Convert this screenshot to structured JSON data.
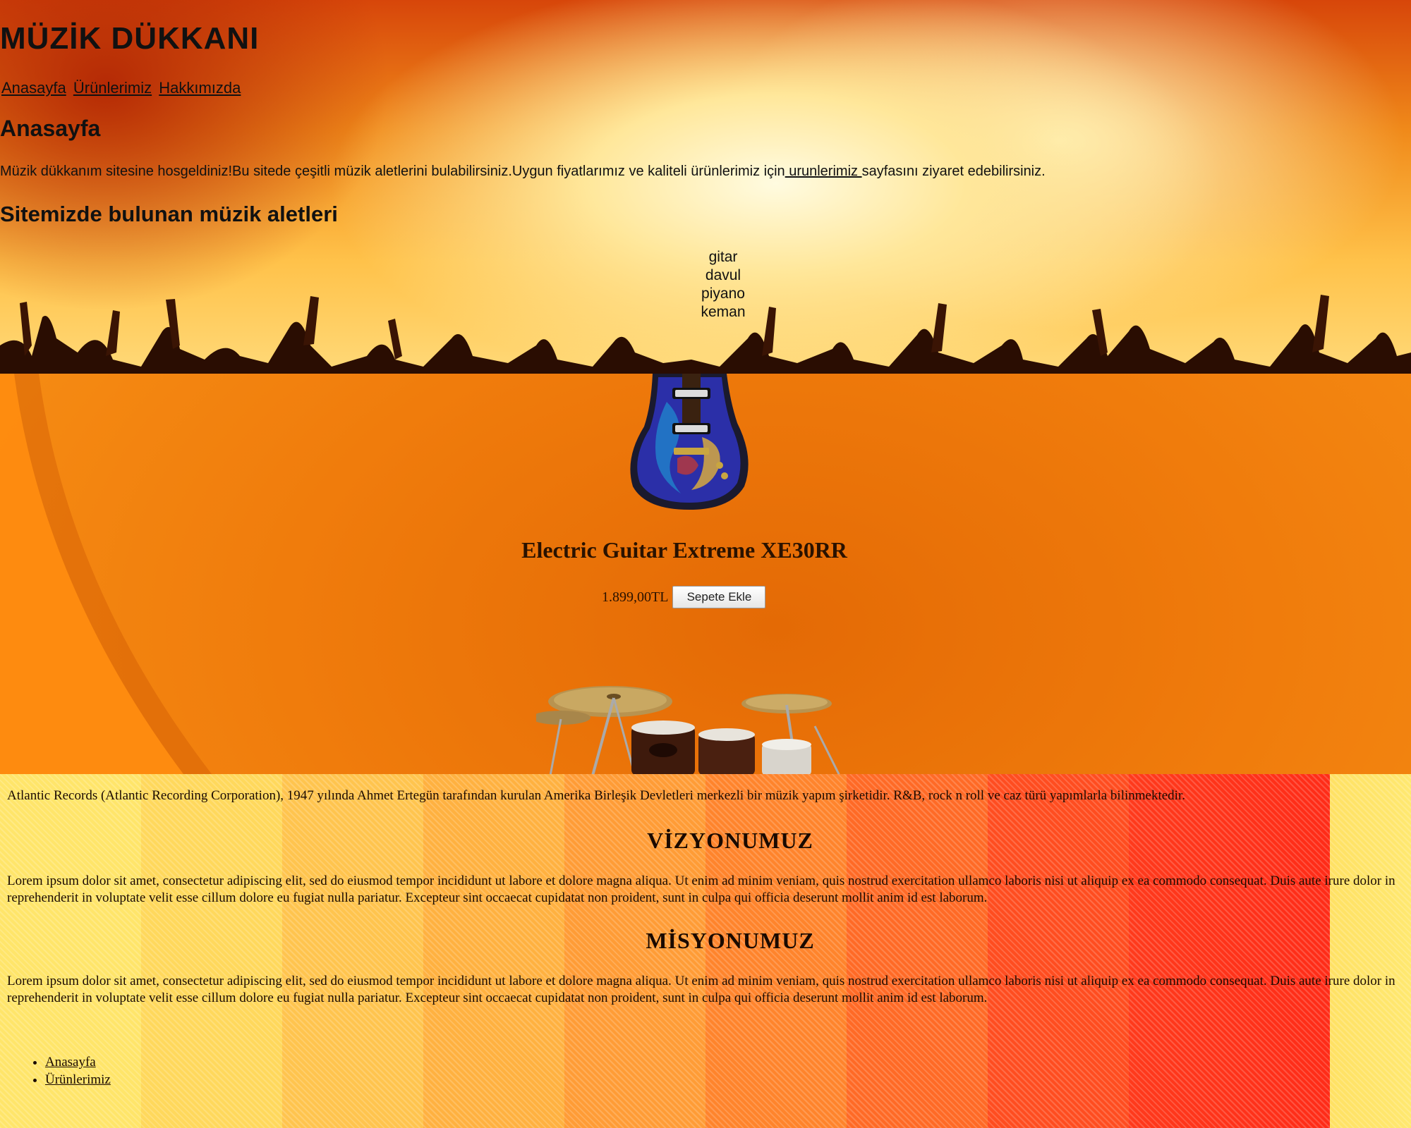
{
  "header": {
    "site_title": "MÜZİK DÜKKANI",
    "nav": [
      "Anasayfa",
      "Ürünlerimiz",
      "Hakkımızda"
    ],
    "page_heading": "Anasayfa",
    "welcome_before": "Müzik dükkanım sitesine hosgeldiniz!Bu sitede çeşitli müzik aletlerini bulabilirsiniz.Uygun fiyatlarımız ve kaliteli ürünlerimiz için",
    "welcome_link": " urunlerimiz ",
    "welcome_after": "sayfasını ziyaret edebilirsiniz.",
    "instruments_heading": "Sitemizde bulunan müzik aletleri",
    "instruments": [
      "gitar",
      "davul",
      "piyano",
      "keman"
    ]
  },
  "product": {
    "name": "Electric Guitar Extreme XE30RR",
    "price": "1.899,00TL",
    "add_to_cart": "Sepete Ekle"
  },
  "about": {
    "intro": "Atlantic Records (Atlantic Recording Corporation), 1947 yılında Ahmet Ertegün tarafından kurulan Amerika Birleşik Devletleri merkezli bir müzik yapım şirketidir. R&B, rock n roll ve caz türü yapımlarla bilinmektedir.",
    "vision_heading": "VİZYONUMUZ",
    "vision_text": "Lorem ipsum dolor sit amet, consectetur adipiscing elit, sed do eiusmod tempor incididunt ut labore et dolore magna aliqua. Ut enim ad minim veniam, quis nostrud exercitation ullamco laboris nisi ut aliquip ex ea commodo consequat. Duis aute irure dolor in reprehenderit in voluptate velit esse cillum dolore eu fugiat nulla pariatur. Excepteur sint occaecat cupidatat non proident, sunt in culpa qui officia deserunt mollit anim id est laborum.",
    "mission_heading": "MİSYONUMUZ",
    "mission_text": "Lorem ipsum dolor sit amet, consectetur adipiscing elit, sed do eiusmod tempor incididunt ut labore et dolore magna aliqua. Ut enim ad minim veniam, quis nostrud exercitation ullamco laboris nisi ut aliquip ex ea commodo consequat. Duis aute irure dolor in reprehenderit in voluptate velit esse cillum dolore eu fugiat nulla pariatur. Excepteur sint occaecat cupidatat non proident, sunt in culpa qui officia deserunt mollit anim id est laborum.",
    "bottom_nav": [
      "Anasayfa",
      "Ürünlerimiz"
    ]
  },
  "images": {
    "hero_background": "concert-crowd-photo",
    "product_image": "electric-guitar-photo",
    "drum_image": "drum-kit-photo"
  }
}
